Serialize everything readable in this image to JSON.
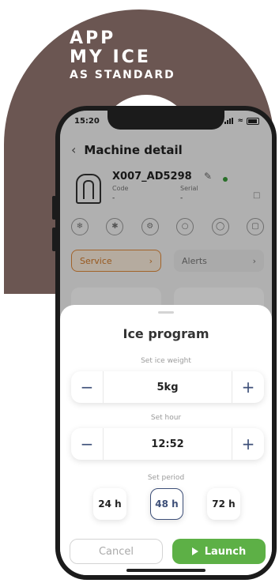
{
  "promo": {
    "line1": "APP",
    "line2": "MY ICE",
    "line3": "AS STANDARD"
  },
  "status": {
    "time": "15:20"
  },
  "header": {
    "back_icon": "chevron-left-icon",
    "title": "Machine detail"
  },
  "machine": {
    "id": "X007_AD5298",
    "code_label": "Code",
    "code_value": "-",
    "serial_label": "Serial",
    "serial_value": "-",
    "online_color": "#3a9a3a"
  },
  "actions": {
    "service_label": "Service",
    "alerts_label": "Alerts"
  },
  "sheet": {
    "title": "Ice program",
    "weight_label": "Set ice weight",
    "weight_value": "5kg",
    "hour_label": "Set hour",
    "hour_value": "12:52",
    "period_label": "Set period",
    "periods": [
      "24 h",
      "48 h",
      "72 h"
    ],
    "selected_period": "48 h",
    "cancel_label": "Cancel",
    "launch_label": "Launch"
  },
  "colors": {
    "brand_brown": "#6b5652",
    "accent_navy": "#3d4f78",
    "launch_green": "#5db046",
    "service_orange": "#e0893a"
  }
}
